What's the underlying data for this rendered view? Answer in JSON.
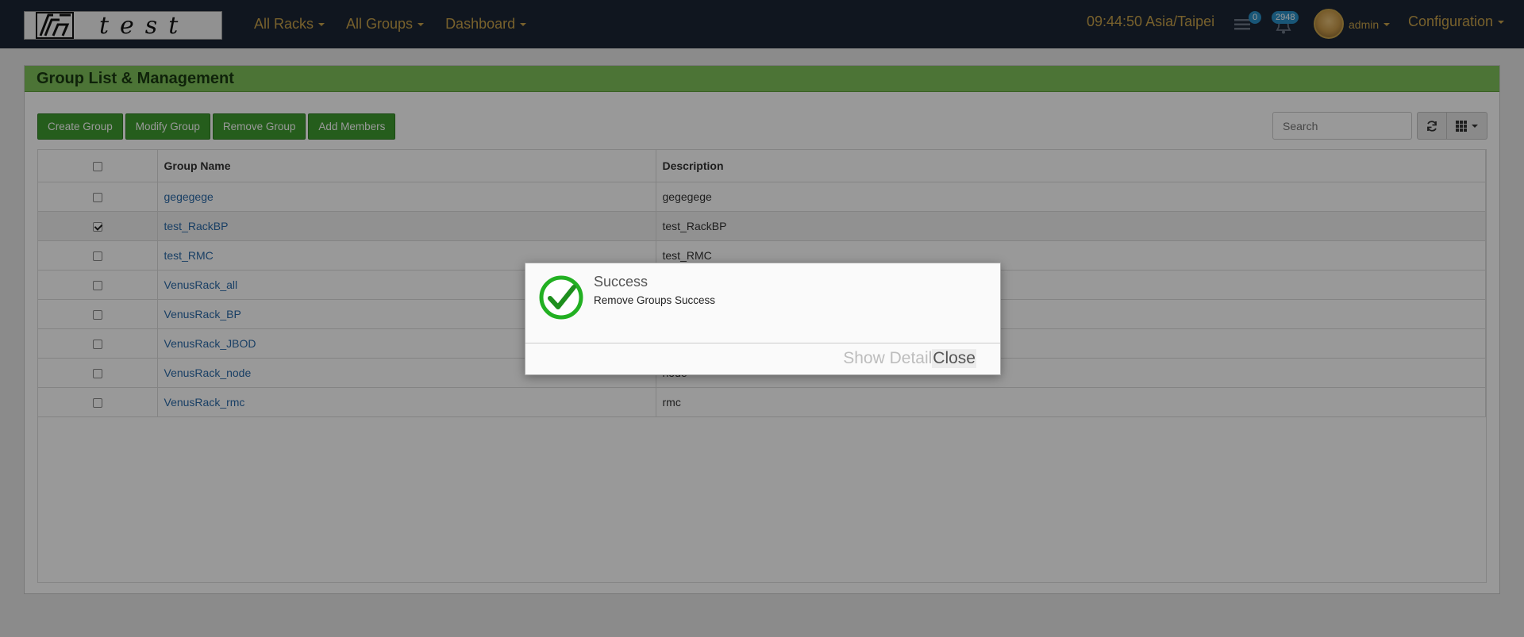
{
  "nav": {
    "menus": [
      {
        "label": "All Racks"
      },
      {
        "label": "All Groups"
      },
      {
        "label": "Dashboard"
      }
    ],
    "clock": "09:44:50 Asia/Taipei",
    "messages_count": "0",
    "alerts_count": "2948",
    "user": "admin",
    "config": "Configuration",
    "logo_text": "test"
  },
  "panel": {
    "title": "Group List & Management",
    "buttons": {
      "create": "Create Group",
      "modify": "Modify Group",
      "remove": "Remove Group",
      "add_members": "Add Members"
    },
    "search_placeholder": "Search"
  },
  "table": {
    "headers": {
      "name": "Group Name",
      "description": "Description"
    },
    "rows": [
      {
        "name": "gegegege",
        "description": "gegegege",
        "checked": false
      },
      {
        "name": "test_RackBP",
        "description": "test_RackBP",
        "checked": true
      },
      {
        "name": "test_RMC",
        "description": "test_RMC",
        "checked": false
      },
      {
        "name": "VenusRack_all",
        "description": "",
        "checked": false
      },
      {
        "name": "VenusRack_BP",
        "description": "",
        "checked": false
      },
      {
        "name": "VenusRack_JBOD",
        "description": "",
        "checked": false
      },
      {
        "name": "VenusRack_node",
        "description": "node",
        "checked": false
      },
      {
        "name": "VenusRack_rmc",
        "description": "rmc",
        "checked": false
      }
    ]
  },
  "modal": {
    "title": "Success",
    "message": "Remove Groups Success",
    "show_detail": "Show Detail",
    "close": "Close"
  },
  "colors": {
    "navbar": "#1b2535",
    "nav_text": "#c8a24a",
    "panel_header": "#7fc25a",
    "button_green": "#3e9b2f",
    "success_green": "#22b022",
    "link": "#2a6aa8"
  }
}
